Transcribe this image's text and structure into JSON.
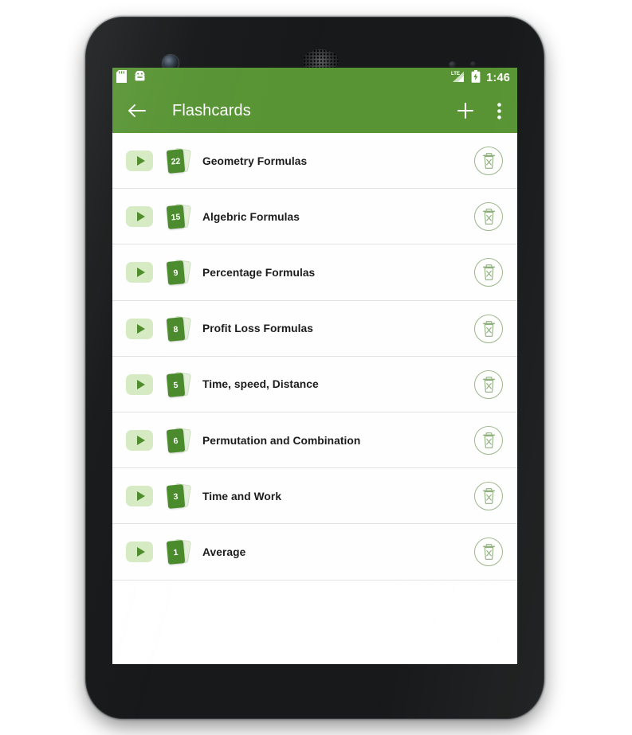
{
  "theme": {
    "accent_green": "#589434",
    "card_front_green": "#4a8b2c",
    "card_back_green": "#e4efda",
    "play_bg_green": "#d6ebc3",
    "delete_outline_green": "#9cb78a",
    "row_bg": "#fefefe",
    "divider": "#e3e3e3",
    "device_body": "#17191a"
  },
  "status_bar": {
    "left_icons": [
      "sd-card-icon",
      "android-robot-icon"
    ],
    "network_label": "LTE",
    "signal_icon": "signal-bars-icon",
    "battery_icon": "battery-charging-icon",
    "time": "1:46"
  },
  "toolbar": {
    "back_icon": "back-arrow-icon",
    "title": "Flashcards",
    "add_icon": "plus-icon",
    "overflow_icon": "overflow-menu-icon"
  },
  "list": {
    "play_icon": "play-icon",
    "cards_icon": "card-stack-icon",
    "delete_icon": "delete-trash-icon",
    "items": [
      {
        "count": "22",
        "title": "Geometry Formulas"
      },
      {
        "count": "15",
        "title": "Algebric Formulas"
      },
      {
        "count": "9",
        "title": "Percentage Formulas"
      },
      {
        "count": "8",
        "title": "Profit Loss Formulas"
      },
      {
        "count": "5",
        "title": "Time, speed, Distance"
      },
      {
        "count": "6",
        "title": "Permutation and Combination"
      },
      {
        "count": "3",
        "title": "Time and Work"
      },
      {
        "count": "1",
        "title": "Average"
      }
    ]
  }
}
